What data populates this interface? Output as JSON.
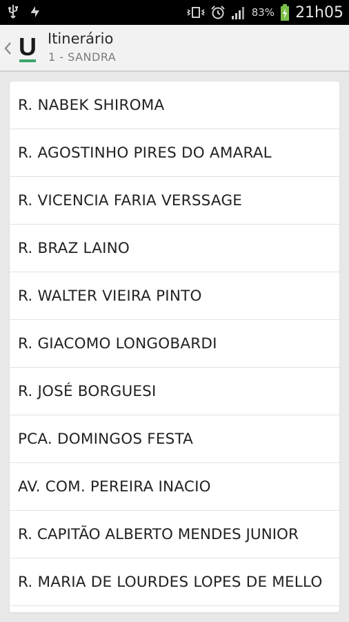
{
  "status_bar": {
    "battery_percent": "83%",
    "time": "21h05",
    "icons": [
      "usb-icon",
      "sync-icon",
      "vibrate-icon",
      "alarm-icon",
      "signal-icon",
      "battery-charging-icon"
    ]
  },
  "action_bar": {
    "title": "Itinerário",
    "subtitle": "1 - SANDRA",
    "logo_letter": "U",
    "accent_color": "#3ba56b"
  },
  "streets": [
    "R. NABEK SHIROMA",
    "R. AGOSTINHO PIRES DO AMARAL",
    "R. VICENCIA FARIA VERSSAGE",
    "R. BRAZ LAINO",
    "R. WALTER VIEIRA PINTO",
    "R. GIACOMO LONGOBARDI",
    "R. JOSÉ BORGUESI",
    "PCA. DOMINGOS FESTA",
    "AV. COM. PEREIRA INACIO",
    "R. CAPITÃO ALBERTO MENDES JUNIOR",
    "R. MARIA DE LOURDES LOPES DE MELLO"
  ]
}
